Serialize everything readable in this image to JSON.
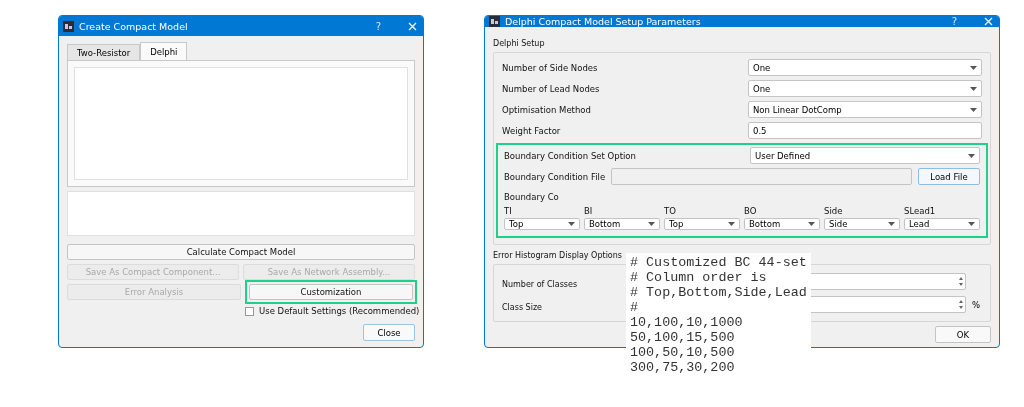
{
  "create_dialog": {
    "title": "Create Compact Model",
    "help": "?",
    "tabs": [
      {
        "label": "Two-Resistor",
        "selected": false
      },
      {
        "label": "Delphi",
        "selected": true
      }
    ],
    "button_rows": [
      [
        {
          "label": "Calculate Compact Model",
          "disabled": false,
          "highlighted": false
        }
      ],
      [
        {
          "label": "Save As Compact Component...",
          "disabled": true,
          "highlighted": false
        },
        {
          "label": "Save As Network Assembly...",
          "disabled": true,
          "highlighted": false
        }
      ],
      [
        {
          "label": "Error Analysis",
          "disabled": true,
          "highlighted": false
        },
        {
          "label": "Customization",
          "disabled": false,
          "highlighted": true
        }
      ]
    ],
    "checkbox": {
      "label": "Use Default Settings (Recommended)",
      "checked": false
    },
    "close_button": "Close"
  },
  "setup_dialog": {
    "title": "Delphi Compact Model Setup Parameters",
    "help": "?",
    "setup": {
      "title": "Delphi Setup",
      "rows": [
        {
          "label": "Number of Side Nodes",
          "kind": "select",
          "value": "One"
        },
        {
          "label": "Number of Lead Nodes",
          "kind": "select",
          "value": "One"
        },
        {
          "label": "Optimisation Method",
          "kind": "select",
          "value": "Non Linear DotComp"
        },
        {
          "label": "Weight Factor",
          "kind": "text",
          "value": "0.5"
        }
      ],
      "boundary": {
        "highlighted": true,
        "option": {
          "label": "Boundary Condition Set Option",
          "value": "User Defined"
        },
        "file": {
          "label": "Boundary Condition File",
          "button": "Load File"
        },
        "label": "Boundary Co",
        "columns": [
          {
            "header": "TI",
            "value": "Top"
          },
          {
            "header": "BI",
            "value": "Bottom"
          },
          {
            "header": "TO",
            "value": "Top"
          },
          {
            "header": "BO",
            "value": "Bottom"
          },
          {
            "header": "Side",
            "value": "Side"
          },
          {
            "header": "SLead1",
            "value": "Lead"
          }
        ]
      }
    },
    "histogram": {
      "title": "Error Histogram Display Options",
      "rows": [
        {
          "label": "Number of Classes"
        },
        {
          "label": "Class Size",
          "unit": "%"
        }
      ]
    },
    "ok_button": "OK"
  },
  "file_excerpt": {
    "lines": [
      "# Customized BC 44-set",
      "# Column order is",
      "# Top,Bottom,Side,Lead",
      "#",
      "10,100,10,1000",
      "50,100,15,500",
      "100,50,10,500",
      "300,75,30,200"
    ]
  }
}
